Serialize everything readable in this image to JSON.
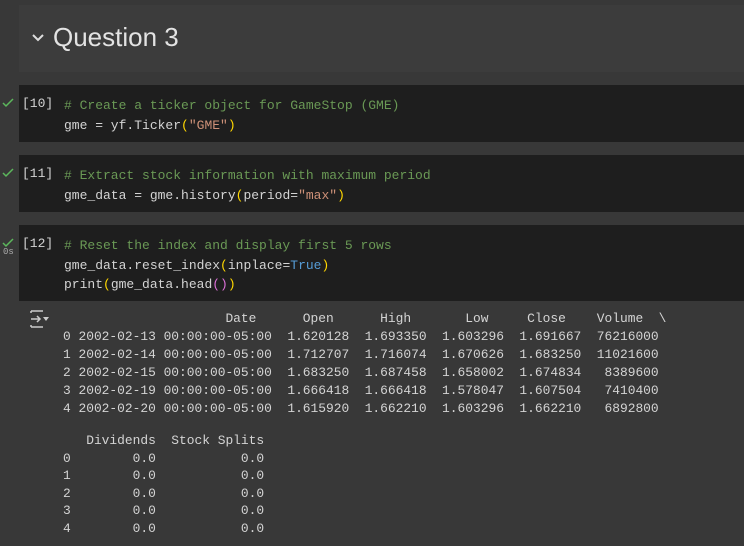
{
  "section": {
    "title": "Question 3"
  },
  "cells": [
    {
      "number": "[10]",
      "lines": [
        [
          [
            "c",
            "# Create a ticker object for GameStop (GME)"
          ]
        ],
        [
          [
            "",
            "gme = yf.Ticker"
          ],
          [
            "p1",
            "("
          ],
          [
            "s",
            "\"GME\""
          ],
          [
            "p1",
            ")"
          ]
        ]
      ]
    },
    {
      "number": "[11]",
      "lines": [
        [
          [
            "c",
            "# Extract stock information with maximum period"
          ]
        ],
        [
          [
            "",
            "gme_data = gme.history"
          ],
          [
            "p1",
            "("
          ],
          [
            "",
            "period="
          ],
          [
            "s",
            "\"max\""
          ],
          [
            "p1",
            ")"
          ]
        ]
      ]
    },
    {
      "number": "[12]",
      "timer": "0s",
      "lines": [
        [
          [
            "c",
            "# Reset the index and display first 5 rows"
          ]
        ],
        [
          [
            "",
            "gme_data.reset_index"
          ],
          [
            "p1",
            "("
          ],
          [
            "",
            "inplace="
          ],
          [
            "k",
            "True"
          ],
          [
            "p1",
            ")"
          ]
        ],
        [
          [
            "",
            "print"
          ],
          [
            "p1",
            "("
          ],
          [
            "",
            "gme_data.head"
          ],
          [
            "p2",
            "()"
          ],
          [
            "p1",
            ")"
          ]
        ]
      ]
    }
  ],
  "output": {
    "table1": [
      "                     Date      Open      High       Low     Close    Volume  \\",
      "0 2002-02-13 00:00:00-05:00  1.620128  1.693350  1.603296  1.691667  76216000",
      "1 2002-02-14 00:00:00-05:00  1.712707  1.716074  1.670626  1.683250  11021600",
      "2 2002-02-15 00:00:00-05:00  1.683250  1.687458  1.658002  1.674834   8389600",
      "3 2002-02-19 00:00:00-05:00  1.666418  1.666418  1.578047  1.607504   7410400",
      "4 2002-02-20 00:00:00-05:00  1.615920  1.662210  1.603296  1.662210   6892800"
    ],
    "table2": [
      "   Dividends  Stock Splits",
      "0        0.0           0.0",
      "1        0.0           0.0",
      "2        0.0           0.0",
      "3        0.0           0.0",
      "4        0.0           0.0"
    ]
  }
}
